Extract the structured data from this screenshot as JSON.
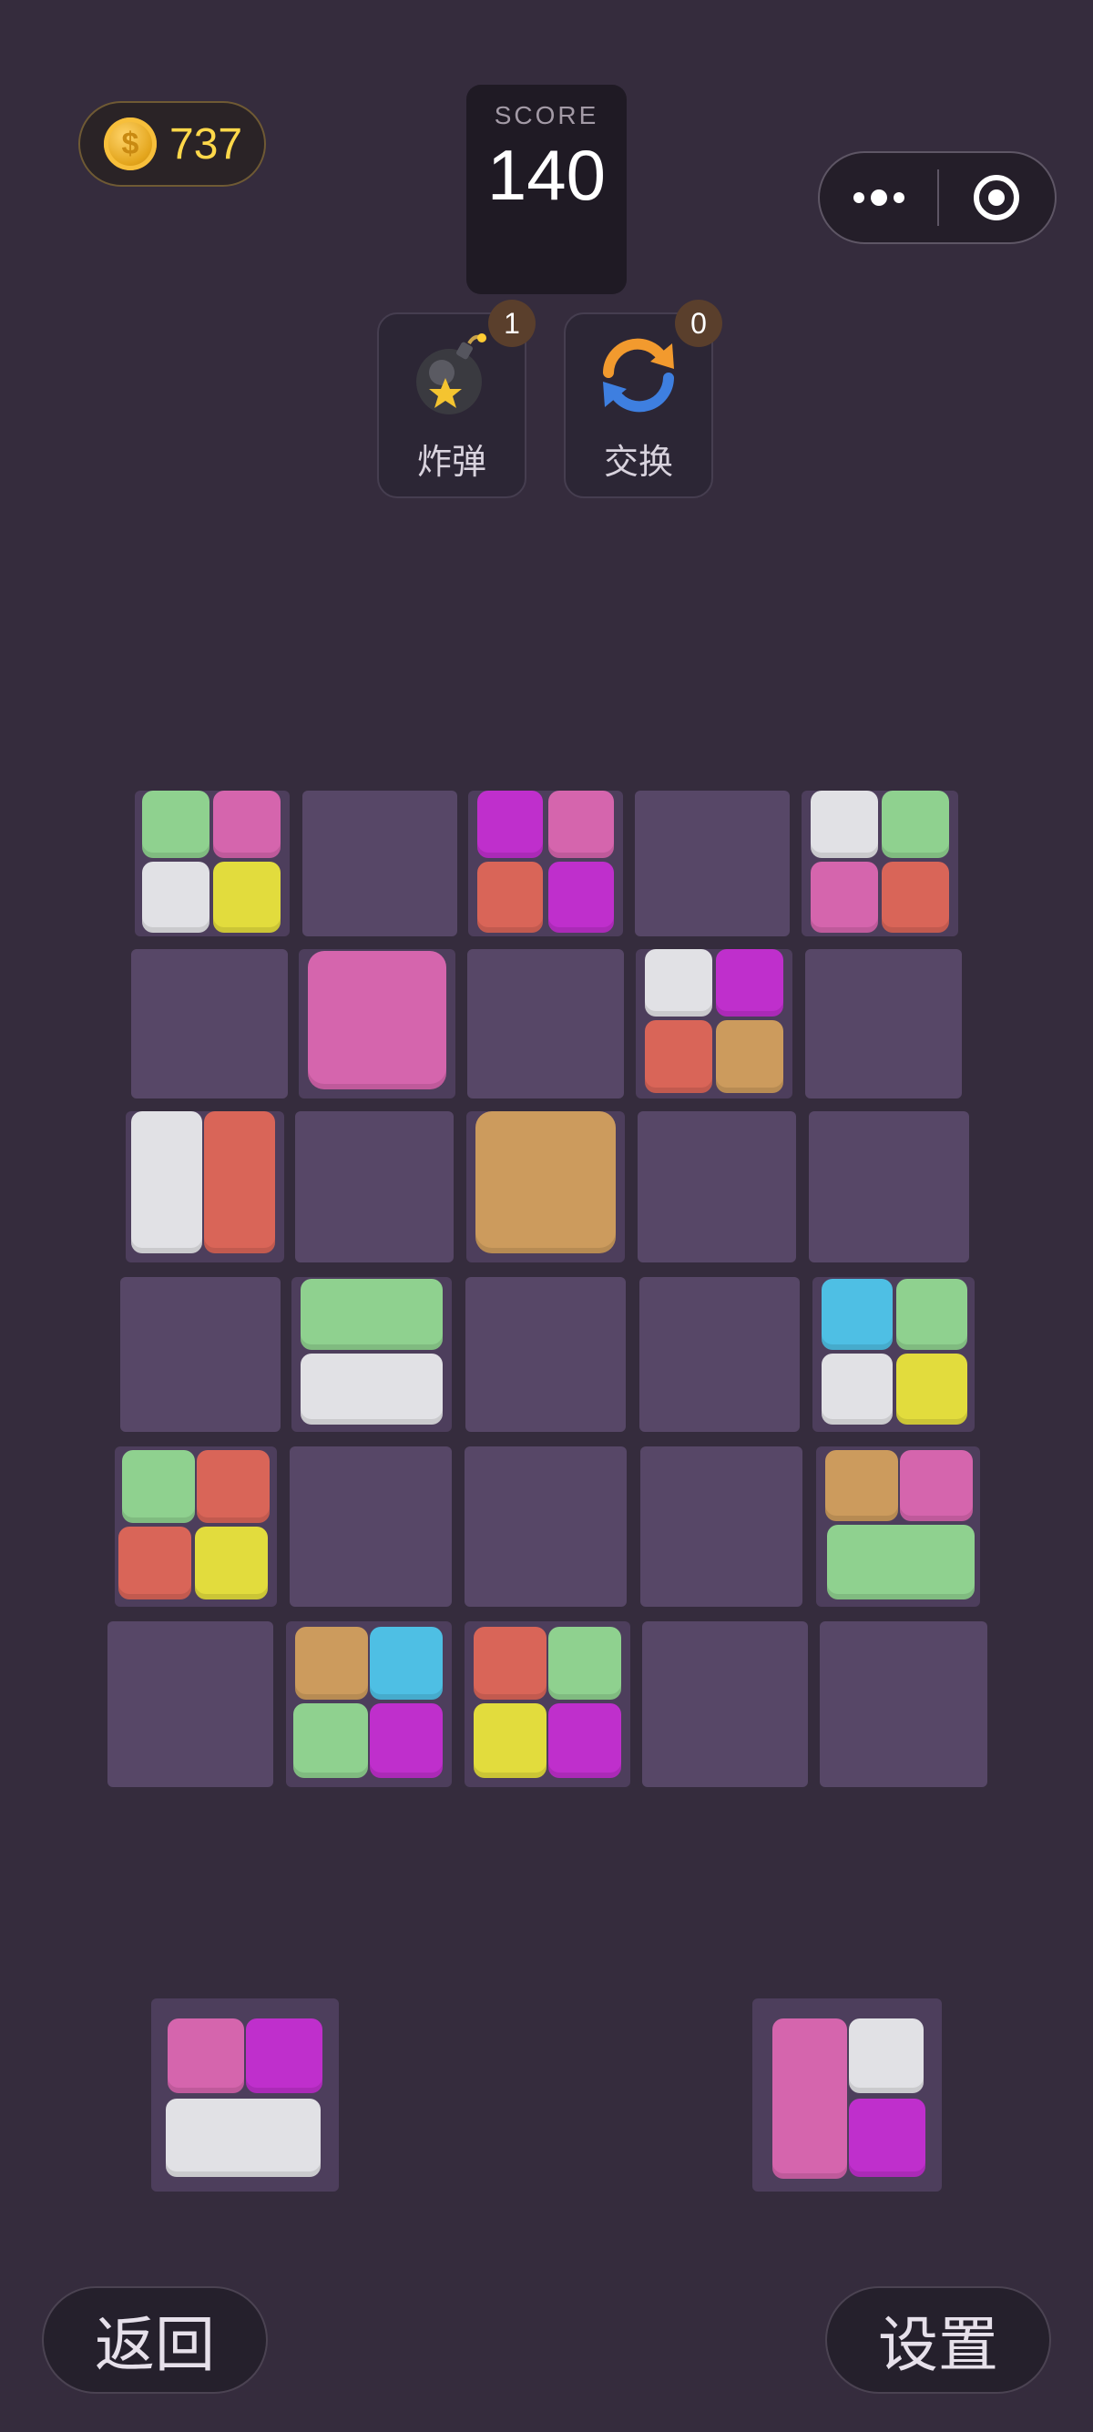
{
  "header": {
    "coins": "737",
    "coin_symbol": "$",
    "score_label": "SCORE",
    "score_value": "140",
    "capsule_more_icon": "more-dots-icon",
    "capsule_close_icon": "target-circle-icon"
  },
  "powerups": [
    {
      "name": "bomb",
      "label": "炸弹",
      "count": "1",
      "icon": "bomb-icon"
    },
    {
      "name": "swap",
      "label": "交换",
      "count": "0",
      "icon": "swap-arrows-icon"
    }
  ],
  "colors": {
    "background": "#352c3d",
    "empty_cell": "#574767",
    "green": "#8fd18f",
    "pink": "#d565ad",
    "white": "#e1e1e5",
    "yellow": "#e2dc3d",
    "magenta": "#bf2fcc",
    "red": "#d96558",
    "tan": "#cc9b5d",
    "cyan": "#4ebfe4"
  },
  "board": {
    "rows": 6,
    "cols": 5,
    "cells": [
      [
        "green,pink / white,yellow",
        "empty",
        "magenta,pink / red,magenta",
        "empty",
        "white,green / pink,red"
      ],
      [
        "empty",
        "pink (full)",
        "empty",
        "white,magenta / red,tan",
        "empty"
      ],
      [
        "white (left) | red (right)",
        "empty",
        "tan (full)",
        "empty",
        "empty"
      ],
      [
        "empty",
        "green (top) / white (bottom)",
        "empty",
        "empty",
        "cyan,green / white,yellow"
      ],
      [
        "green,red / red,yellow",
        "empty",
        "empty",
        "empty",
        "tan,pink / green (bottom)"
      ],
      [
        "empty",
        "tan,cyan / green,magenta",
        "red,green / yellow,magenta",
        "empty",
        "empty"
      ]
    ]
  },
  "tray": [
    "pink,magenta / white (bottom)",
    "pink (left) | white (top-right), magenta (bottom-right)"
  ],
  "footer": {
    "back_label": "返回",
    "settings_label": "设置"
  }
}
